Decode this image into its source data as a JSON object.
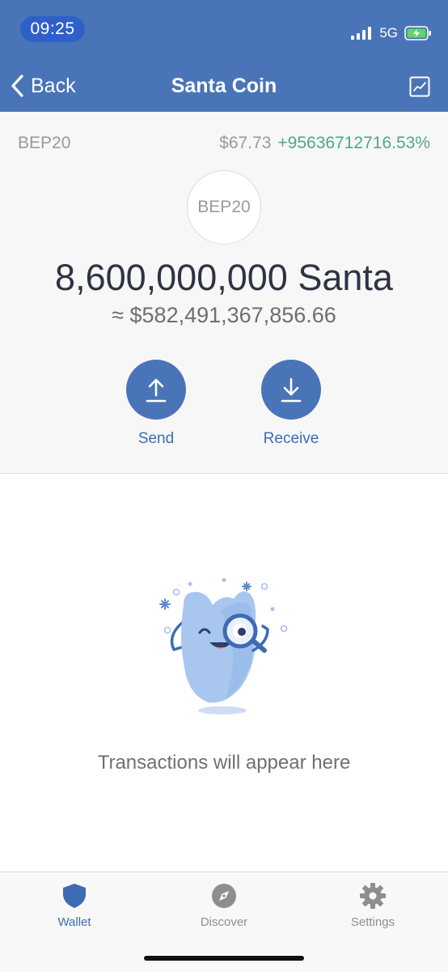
{
  "status_bar": {
    "time": "09:25",
    "network": "5G",
    "icons": [
      "signal-bars-icon",
      "battery-charging-icon"
    ]
  },
  "nav": {
    "back_label": "Back",
    "title": "Santa Coin",
    "chart_icon": "price-chart-icon"
  },
  "token": {
    "standard": "BEP20",
    "price": "$67.73",
    "change": "+95636712716.53%",
    "logo_text": "BEP20",
    "balance": "8,600,000,000 Santa",
    "fiat_balance": "≈ $582,491,367,856.66"
  },
  "actions": {
    "send_label": "Send",
    "receive_label": "Receive",
    "send_icon": "upload-arrow-icon",
    "receive_icon": "download-arrow-icon"
  },
  "transactions": {
    "empty_text": "Transactions will appear here",
    "illustration": "mascot-magnifier-illustration"
  },
  "tab_bar": {
    "active": "Wallet",
    "tabs": [
      {
        "label": "Wallet",
        "icon": "shield-icon"
      },
      {
        "label": "Discover",
        "icon": "compass-icon"
      },
      {
        "label": "Settings",
        "icon": "gear-icon"
      }
    ]
  },
  "colors": {
    "header": "#4a74b8",
    "accent": "#3e6bb3",
    "positive_change": "#52a68a",
    "balance_text": "#2e3344",
    "tab_inactive": "#8e8e8e"
  }
}
